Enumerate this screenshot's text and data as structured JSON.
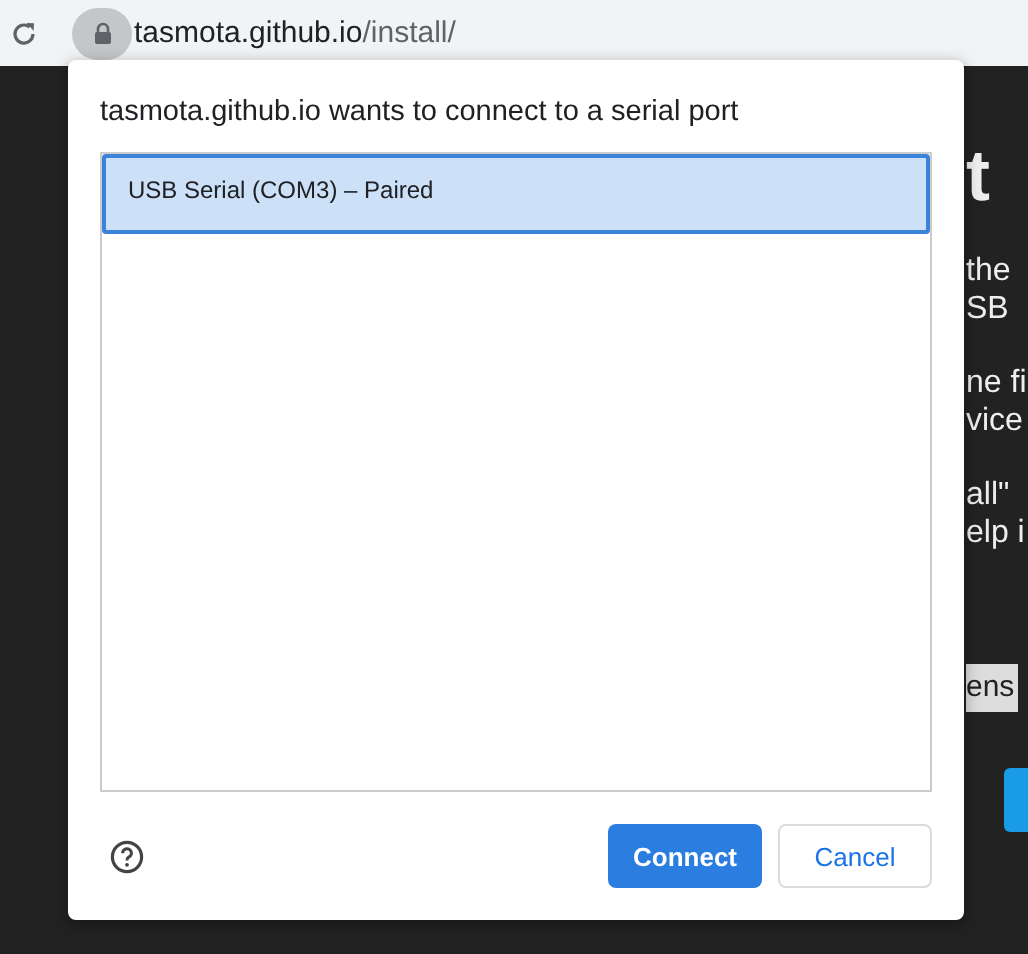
{
  "address_bar": {
    "host": "tasmota.github.io",
    "path": "/install/"
  },
  "page": {
    "heading": "t",
    "paragraphs": [
      [
        "the",
        "SB"
      ],
      [
        "ne fi",
        "vice"
      ],
      [
        "all\"",
        "elp i"
      ]
    ],
    "select_value": "ens"
  },
  "dialog": {
    "title": "tasmota.github.io wants to connect to a serial port",
    "ports": [
      {
        "label": "USB Serial (COM3) – Paired",
        "selected": true
      }
    ],
    "buttons": [
      {
        "label": "Connect",
        "kind": "primary"
      },
      {
        "label": "Cancel",
        "kind": "secondary"
      }
    ]
  }
}
